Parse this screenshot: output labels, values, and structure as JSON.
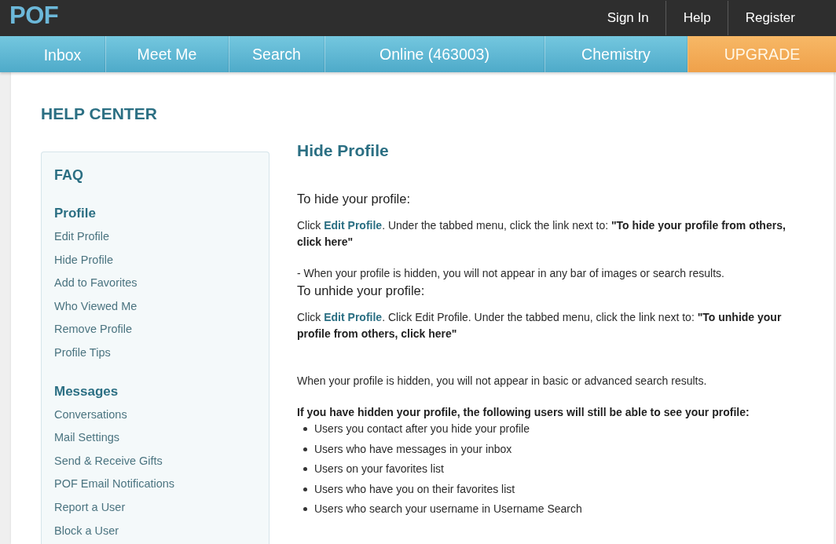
{
  "top_bar": {
    "logo": "POF",
    "links": [
      "Sign In",
      "Help",
      "Register"
    ]
  },
  "nav_tabs": [
    {
      "label": "Inbox",
      "kind": "tab"
    },
    {
      "label": "Meet Me",
      "kind": "tab"
    },
    {
      "label": "Search",
      "kind": "tab"
    },
    {
      "label": "Online (463003)",
      "kind": "tab"
    },
    {
      "label": "Chemistry",
      "kind": "tab"
    },
    {
      "label": "UPGRADE",
      "kind": "upgrade"
    }
  ],
  "page_title": "HELP CENTER",
  "sidebar": {
    "title": "FAQ",
    "sections": [
      {
        "heading": "Profile",
        "items": [
          "Edit Profile",
          "Hide Profile",
          "Add to Favorites",
          "Who Viewed Me",
          "Remove Profile",
          "Profile Tips"
        ]
      },
      {
        "heading": "Messages",
        "items": [
          "Conversations",
          "Mail Settings",
          "Send & Receive Gifts",
          "POF Email Notifications",
          "Report a User",
          "Block a User"
        ]
      }
    ]
  },
  "article": {
    "title": "Hide Profile",
    "sections": [
      {
        "heading": "To hide your profile:",
        "paragraph": [
          {
            "kind": "text",
            "text": "Click "
          },
          {
            "kind": "link",
            "text": "Edit Profile"
          },
          {
            "kind": "text",
            "text": ". Under the tabbed menu, click the link next to: "
          },
          {
            "kind": "bold",
            "text": "\"To hide your profile from others, click here\""
          }
        ],
        "note": "- When your profile is hidden, you will not appear in any bar of images or search results."
      },
      {
        "heading": "To unhide your profile:",
        "paragraph": [
          {
            "kind": "text",
            "text": "Click "
          },
          {
            "kind": "link",
            "text": "Edit Profile"
          },
          {
            "kind": "text",
            "text": ". Click Edit Profile. Under the tabbed menu, click the link next to: "
          },
          {
            "kind": "bold",
            "text": "\"To unhide your profile from others, click here\""
          }
        ]
      }
    ],
    "summary": "When your profile is hidden, you will not appear in basic or advanced search results.",
    "visible_to": {
      "intro": "If you have hidden your profile, the following users will still be able to see your profile:",
      "items": [
        "Users you contact after you hide your profile",
        "Users who have messages in your inbox",
        "Users on your favorites list",
        "Users who have you on their favorites list",
        "Users who search your username in Username Search"
      ]
    }
  }
}
